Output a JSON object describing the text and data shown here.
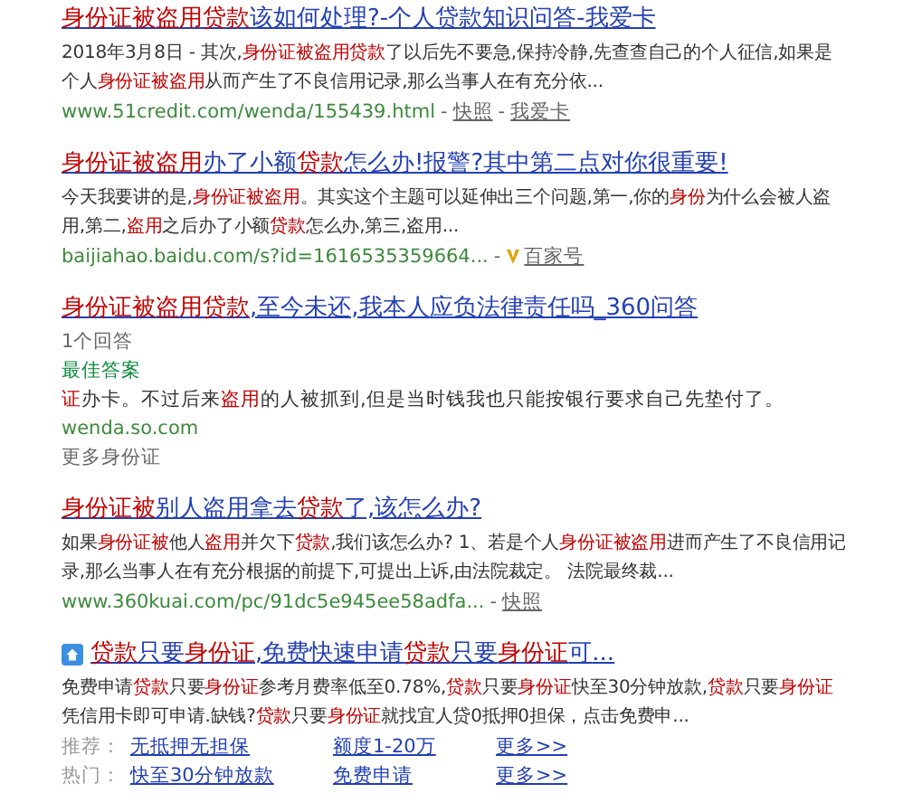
{
  "results": [
    {
      "kind": "organic",
      "title": [
        {
          "text": "身份证被盗用贷款",
          "highlight": true
        },
        {
          "text": "该如何处理?-个人贷款知识问答-我爱卡",
          "highlight": false
        }
      ],
      "snippet": [
        {
          "text": "2018年3月8日 - 其次,",
          "highlight": false
        },
        {
          "text": "身份证被盗用贷款",
          "highlight": true
        },
        {
          "text": "了以后先不要急,保持冷静,先查查自己的个人征信,如果是个人",
          "highlight": false
        },
        {
          "text": "身份证被盗用",
          "highlight": true
        },
        {
          "text": "从而产生了不良信用记录,那么当事人在有充分依...",
          "highlight": false
        }
      ],
      "url": "www.51credit.com/wenda/155439.html",
      "separator": "-",
      "links": [
        "快照",
        "我爱卡"
      ],
      "verified": false
    },
    {
      "kind": "organic",
      "title": [
        {
          "text": "身份证被盗用",
          "highlight": true
        },
        {
          "text": "办了小额",
          "highlight": false
        },
        {
          "text": "贷款",
          "highlight": true
        },
        {
          "text": "怎么办!报警?其中第二点对你很重要!",
          "highlight": false
        }
      ],
      "snippet": [
        {
          "text": "今天我要讲的是,",
          "highlight": false
        },
        {
          "text": "身份证被盗用",
          "highlight": true
        },
        {
          "text": "。其实这个主题可以延伸出三个问题,第一,你的",
          "highlight": false
        },
        {
          "text": "身份",
          "highlight": true
        },
        {
          "text": "为什么会被人盗用,第二,",
          "highlight": false
        },
        {
          "text": "盗用",
          "highlight": true
        },
        {
          "text": "之后办了小额",
          "highlight": false
        },
        {
          "text": "贷款",
          "highlight": true
        },
        {
          "text": "怎么办,第三,盗用...",
          "highlight": false
        }
      ],
      "url": "baijiahao.baidu.com/s?id=1616535359664...",
      "separator": "-",
      "links": [
        "百家号"
      ],
      "verified": true
    },
    {
      "kind": "qa",
      "title": [
        {
          "text": "身份证被盗用贷款",
          "highlight": true
        },
        {
          "text": ",至今未还,我本人应负法律责任吗_360问答",
          "highlight": false
        }
      ],
      "meta": "1个回答",
      "best_label": "最佳答案",
      "snippet": [
        {
          "text": "证",
          "highlight": true
        },
        {
          "text": "办卡。不过后来",
          "highlight": false
        },
        {
          "text": "盗用",
          "highlight": true
        },
        {
          "text": "的人被抓到,但是当时钱我也只能按银行要求自己先垫付了。",
          "highlight": false
        }
      ],
      "url": "wenda.so.com",
      "more": "更多身份证"
    },
    {
      "kind": "organic",
      "title": [
        {
          "text": "身份证被",
          "highlight": true
        },
        {
          "text": "别人盗用",
          "highlight": false
        },
        {
          "text": "拿去",
          "highlight": false
        },
        {
          "text": "贷款",
          "highlight": true
        },
        {
          "text": "了,该怎么办?",
          "highlight": false
        }
      ],
      "snippet": [
        {
          "text": "如果",
          "highlight": false
        },
        {
          "text": "身份证被",
          "highlight": true
        },
        {
          "text": "他人",
          "highlight": false
        },
        {
          "text": "盗用",
          "highlight": true
        },
        {
          "text": "并欠下",
          "highlight": false
        },
        {
          "text": "贷款",
          "highlight": true
        },
        {
          "text": ",我们该怎么办? 1、若是个人",
          "highlight": false
        },
        {
          "text": "身份证被盗用",
          "highlight": true
        },
        {
          "text": "进而产生了不良信用记录,那么当事人在有充分根据的前提下,可提出上诉,由法院裁定。 法院最终裁...",
          "highlight": false
        }
      ],
      "url": "www.360kuai.com/pc/91dc5e945ee58adfa...",
      "separator": "-",
      "links": [
        "快照"
      ],
      "verified": false
    },
    {
      "kind": "ad",
      "title": [
        {
          "text": "贷款",
          "highlight": true
        },
        {
          "text": "只要",
          "highlight": false
        },
        {
          "text": "身份证",
          "highlight": true
        },
        {
          "text": ",免费快速申请",
          "highlight": false
        },
        {
          "text": "贷款",
          "highlight": true
        },
        {
          "text": "只要",
          "highlight": false
        },
        {
          "text": "身份证",
          "highlight": true
        },
        {
          "text": "可",
          "highlight": false
        }
      ],
      "title_tail": "...",
      "snippet": [
        {
          "text": "免费申请",
          "highlight": false
        },
        {
          "text": "贷款",
          "highlight": true
        },
        {
          "text": "只要",
          "highlight": false
        },
        {
          "text": "身份证",
          "highlight": true
        },
        {
          "text": "参考月费率低至0.78%,",
          "highlight": false
        },
        {
          "text": "贷款",
          "highlight": true
        },
        {
          "text": "只要",
          "highlight": false
        },
        {
          "text": "身份证",
          "highlight": true
        },
        {
          "text": "快至30分钟放款,",
          "highlight": false
        },
        {
          "text": "贷款",
          "highlight": true
        },
        {
          "text": "只要",
          "highlight": false
        },
        {
          "text": "身份证",
          "highlight": true
        },
        {
          "text": "凭信用卡即可申请.缺钱?",
          "highlight": false
        },
        {
          "text": "贷款",
          "highlight": true
        },
        {
          "text": "只要",
          "highlight": false
        },
        {
          "text": "身份证",
          "highlight": true
        },
        {
          "text": "就找宜人贷0抵押0担保，点击免费申...",
          "highlight": false
        }
      ],
      "rows": [
        {
          "label": "推荐：",
          "links": [
            "无抵押无担保",
            "额度1-20万",
            "更多>>"
          ]
        },
        {
          "label": "热门：",
          "links": [
            "快至30分钟放款",
            "免费申请",
            "更多>>"
          ]
        }
      ]
    }
  ]
}
